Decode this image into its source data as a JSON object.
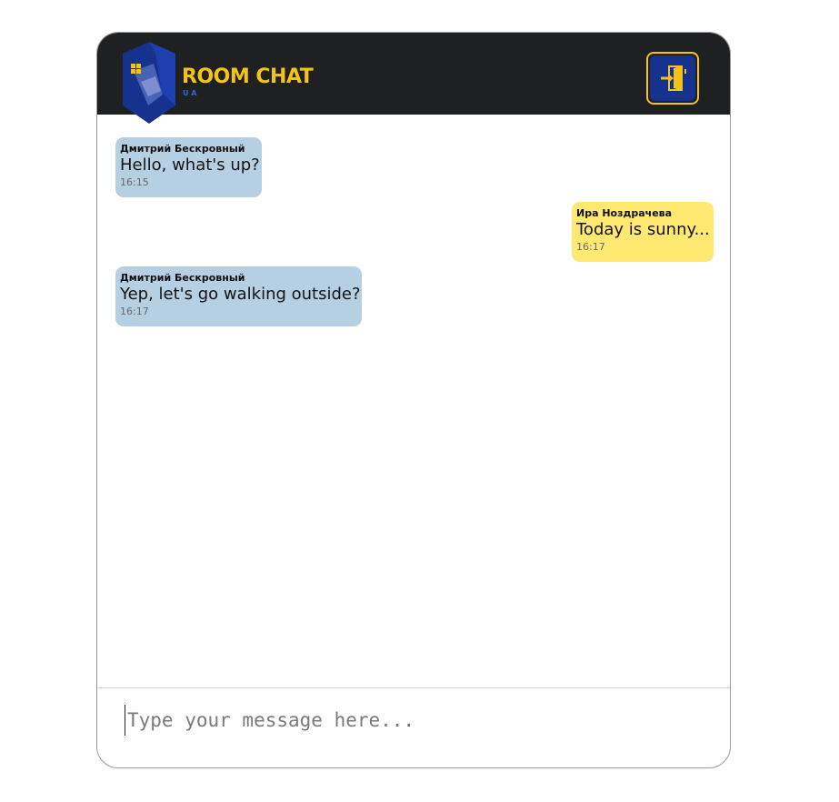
{
  "header": {
    "brand_title": "ROOM CHAT",
    "brand_subtitle": "UA",
    "exit_icon": "exit-door-icon",
    "logo_icon": "shield-window-logo"
  },
  "messages": [
    {
      "sender": "Дмитрий Бескровный",
      "text": "Hello, what's up?",
      "time": "16:15",
      "direction": "incoming"
    },
    {
      "sender": "Ира Ноздрачева",
      "text": "Today is sunny...",
      "time": "16:17",
      "direction": "outgoing"
    },
    {
      "sender": "Дмитрий Бескровный",
      "text": "Yep, let's go walking outside?",
      "time": "16:17",
      "direction": "incoming"
    }
  ],
  "composer": {
    "placeholder": "Type your message here...",
    "value": ""
  },
  "colors": {
    "header_bg": "#1f2022",
    "accent_yellow": "#f3c318",
    "brand_blue": "#17318f",
    "incoming_bubble": "#b5cfe3",
    "outgoing_bubble": "#ffe971"
  }
}
